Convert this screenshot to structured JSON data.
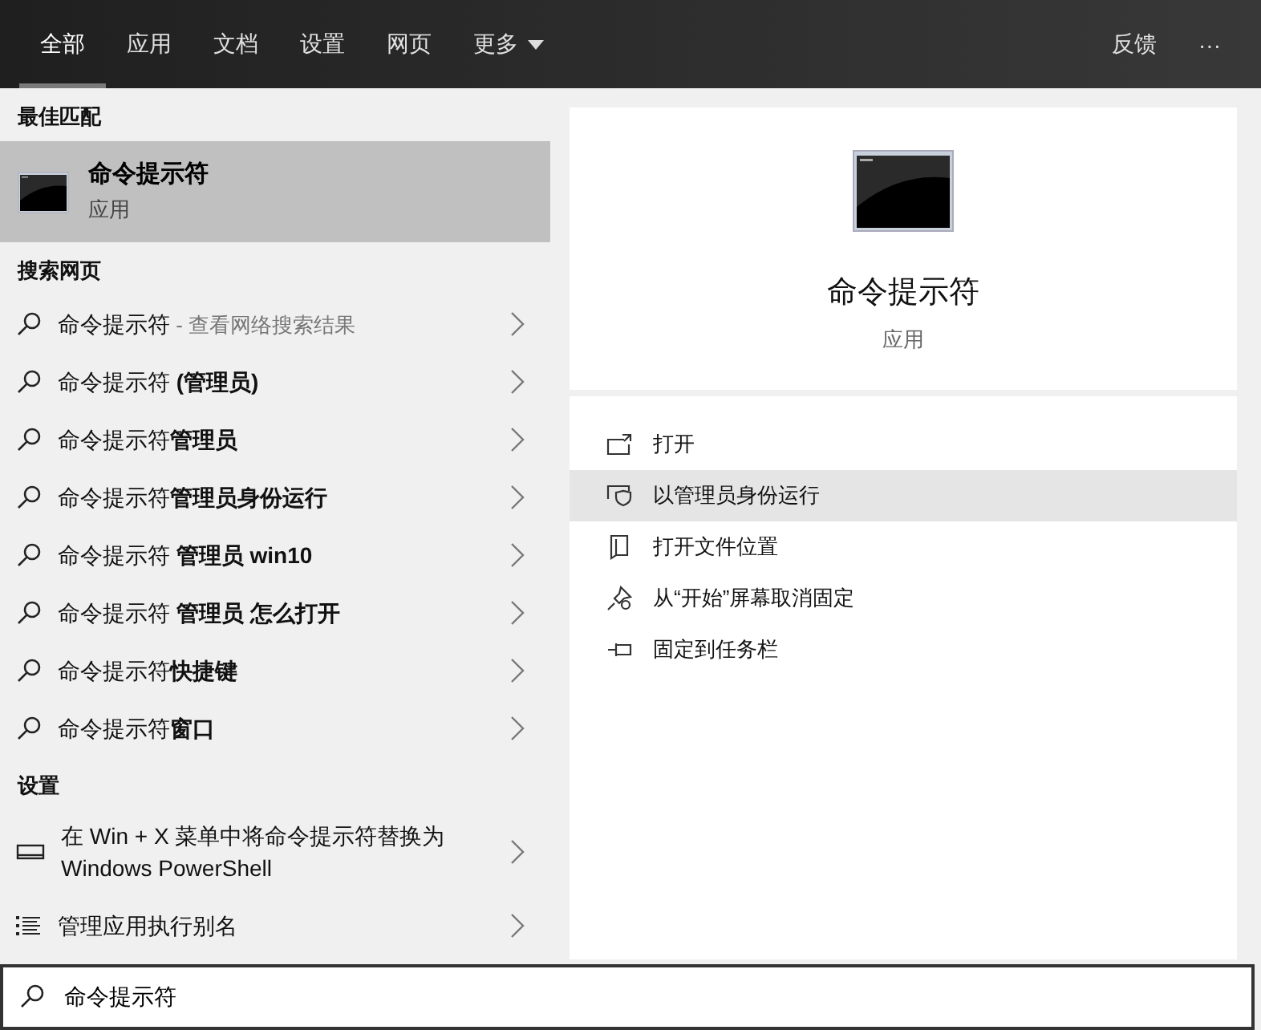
{
  "tabs": [
    {
      "label": "全部",
      "selected": true
    },
    {
      "label": "应用",
      "selected": false
    },
    {
      "label": "文档",
      "selected": false
    },
    {
      "label": "设置",
      "selected": false
    },
    {
      "label": "网页",
      "selected": false
    },
    {
      "label": "更多",
      "selected": false,
      "dropdown": true
    }
  ],
  "top_actions": {
    "feedback": "反馈",
    "more": "···"
  },
  "best_match": {
    "heading": "最佳匹配",
    "name": "命令提示符",
    "type": "应用",
    "selected": true
  },
  "web_search": {
    "heading": "搜索网页",
    "items": [
      {
        "text": "命令提示符",
        "note": "- 查看网络搜索结果"
      },
      {
        "text": "命令提示符 **(管理员)**"
      },
      {
        "text": "命令提示符**管理员**"
      },
      {
        "text": "命令提示符**管理员身份运行**"
      },
      {
        "text": "命令提示符 **管理员 win10**"
      },
      {
        "text": "命令提示符 **管理员 怎么打开**"
      },
      {
        "text": "命令提示符**快捷键**"
      },
      {
        "text": "命令提示符**窗口**"
      }
    ]
  },
  "settings": {
    "heading": "设置",
    "items": [
      {
        "kind": "display",
        "text": "在 Win + X 菜单中将命令提示符替换为 Windows PowerShell"
      },
      {
        "kind": "list",
        "text": "管理应用执行别名"
      }
    ]
  },
  "preview": {
    "name": "命令提示符",
    "type": "应用",
    "actions": [
      {
        "kind": "open",
        "label": "打开",
        "selected": false
      },
      {
        "kind": "admin",
        "label": "以管理员身份运行",
        "selected": true
      },
      {
        "kind": "folder",
        "label": "打开文件位置",
        "selected": false
      },
      {
        "kind": "unpin",
        "label": "从“开始”屏幕取消固定",
        "selected": false
      },
      {
        "kind": "pin",
        "label": "固定到任务栏",
        "selected": false
      }
    ]
  },
  "search_box": {
    "value": "命令提示符"
  }
}
